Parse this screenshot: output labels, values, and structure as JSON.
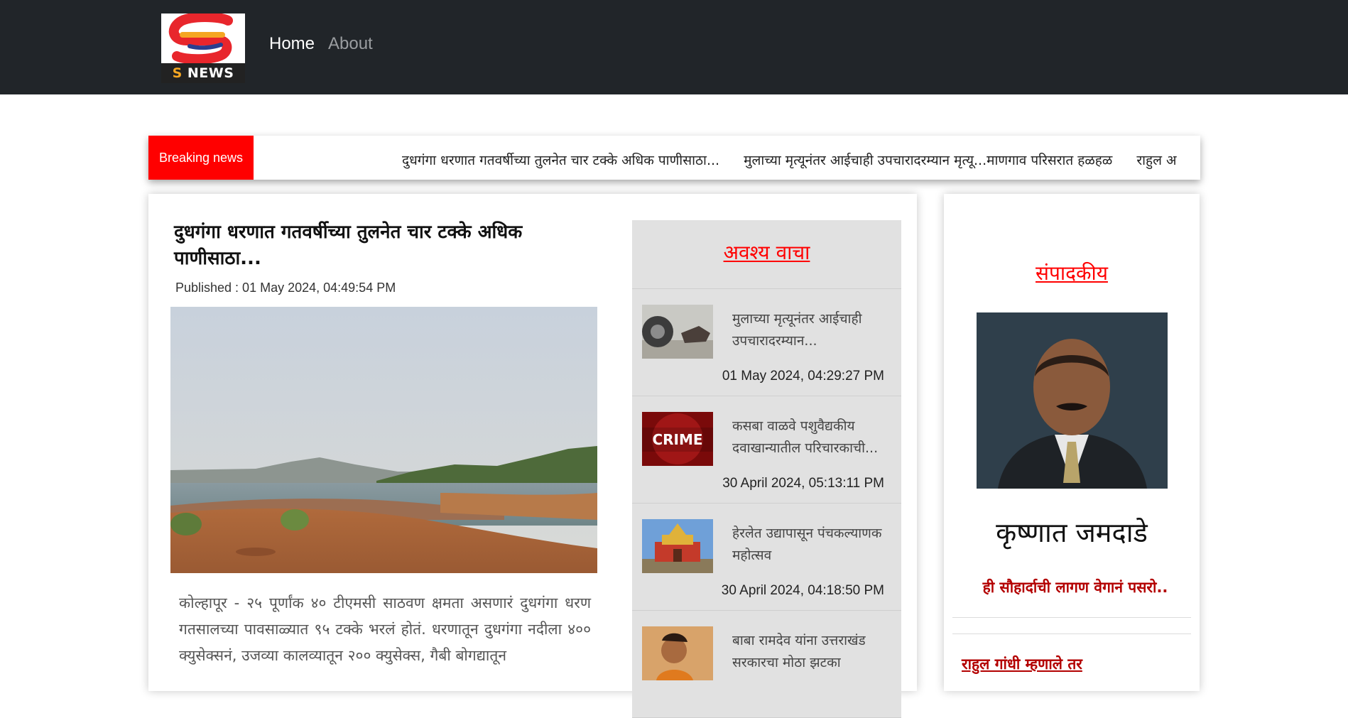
{
  "nav": {
    "logo_text_s": "S",
    "logo_text_rest": "NEWS",
    "home_label": "Home",
    "about_label": "About"
  },
  "breaking": {
    "label": "Breaking news",
    "items": [
      "दुधगंगा धरणात गतवर्षीच्या तुलनेत चार टक्के अधिक पाणीसाठा...",
      "मुलाच्या मृत्यूनंतर आईचाही उपचारादरम्यान मृत्यू...माणगाव परिसरात हळहळ",
      "राहुल अ"
    ]
  },
  "article": {
    "title": "दुधगंगा धरणात गतवर्षीच्या तुलनेत चार टक्के अधिक पाणीसाठा...",
    "published": "Published : 01 May 2024, 04:49:54 PM",
    "body": "कोल्हापूर - २५ पूर्णांक ४० टीएमसी साठवण क्षमता असणारं दुधगंगा धरण गतसालच्या पावसाळ्यात ९५ टक्के भरलं होतं. धरणातून दुधगंगा नदीला ४०० क्युसेक्सनं, उजव्या कालव्यातून २०० क्युसेक्स, गैबी बोगद्यातून"
  },
  "must_read": {
    "title": "अवश्य वाचा",
    "items": [
      {
        "text": "मुलाच्या मृत्यूनंतर आईचाही उपचारादरम्यान...",
        "date": "01 May 2024, 04:29:27 PM"
      },
      {
        "text": "कसबा वाळवे पशुवैद्यकीय दवाखान्यातील परिचारकाची...",
        "date": "30 April 2024, 05:13:11 PM",
        "thumb_label": "CRIME"
      },
      {
        "text": "हेरलेत उद्यापासून पंचकल्याणक महोत्सव",
        "date": "30 April 2024, 04:18:50 PM"
      },
      {
        "text": "बाबा रामदेव यांना उत्तराखंड सरकारचा मोठा झटका",
        "date": ""
      }
    ]
  },
  "editorial": {
    "title": "संपादकीय",
    "editor_name": "कृष्णात जमदाडे",
    "link_1": "ही सौहार्दाची लागण वेगानं पसरो..",
    "link_2": "राहुल गांधी म्हणाले तर"
  },
  "colors": {
    "navbar": "#212529",
    "breaking_label": "#ff0000",
    "section_title": "#ff0000",
    "editorial_link": "#b30000",
    "must_read_bg": "#e1e1e1"
  }
}
